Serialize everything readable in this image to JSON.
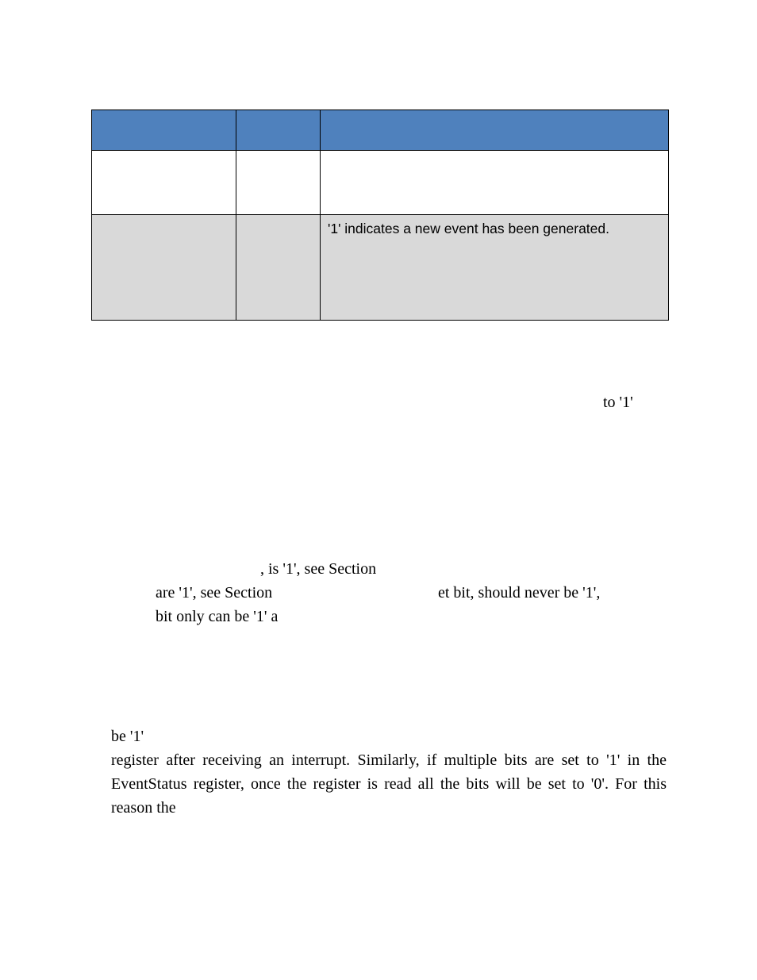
{
  "table": {
    "row2_desc": "'1' indicates a new event has been generated."
  },
  "body": {
    "to1": "to  '1'",
    "line_a": ", is '1', see Section",
    "line_b_left": "are '1', see Section",
    "line_b_right": "et bit, should never be '1',",
    "line_c": "bit only can be '1' a",
    "be1": "be '1'",
    "para_tail": "register  after  receiving  an  interrupt.    Similarly,  if  multiple  bits  are  set  to  '1'  in  the EventStatus register, once the register is read all the bits will be set to '0'.  For this reason the"
  }
}
